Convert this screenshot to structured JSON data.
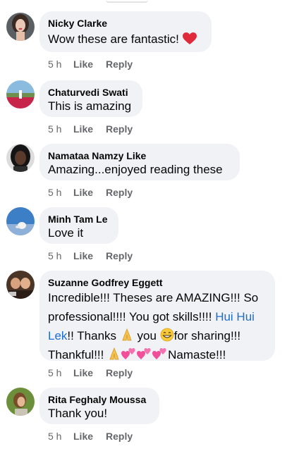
{
  "comments": [
    {
      "author": "Nicky Clarke",
      "text": "Wow these are fantastic! ",
      "emoji": "red-heart",
      "time": "5 h",
      "like": "Like",
      "reply": "Reply"
    },
    {
      "author": "Chaturvedi Swati",
      "text": "This is amazing",
      "time": "5 h",
      "like": "Like",
      "reply": "Reply"
    },
    {
      "author": "Namataa Namzy Like",
      "text": "Amazing...enjoyed reading these",
      "time": "5 h",
      "like": "Like",
      "reply": "Reply"
    },
    {
      "author": "Minh Tam Le",
      "text": "Love it",
      "time": "5 h",
      "like": "Like",
      "reply": "Reply"
    },
    {
      "author": "Suzanne Godfrey Eggett",
      "text_part1": "Incredible!!! Theses are AMAZING!!! So professional!!!! You got skills!!!! ",
      "mention": "Hui Hui Lek",
      "text_part2": "!! Thanks ",
      "text_part3": " you ",
      "text_part4": "for sharing!!!",
      "text_part5": "Thankful!!! ",
      "text_part6": "Namaste!!!",
      "time": "5 h",
      "like": "Like",
      "reply": "Reply"
    },
    {
      "author": "Rita Feghaly Moussa",
      "text": "Thank you!",
      "time": "5 h",
      "like": "Like",
      "reply": "Reply"
    }
  ],
  "colors": {
    "bubble": "#f0f2f5",
    "mention": "#1a6fd1",
    "meta": "#65676b",
    "heart": "#e0293b",
    "sparkling_heart": "#f14f9a"
  },
  "icons": [
    "red-heart-icon",
    "folded-hands-icon",
    "grinning-face-icon",
    "two-hearts-icon"
  ]
}
